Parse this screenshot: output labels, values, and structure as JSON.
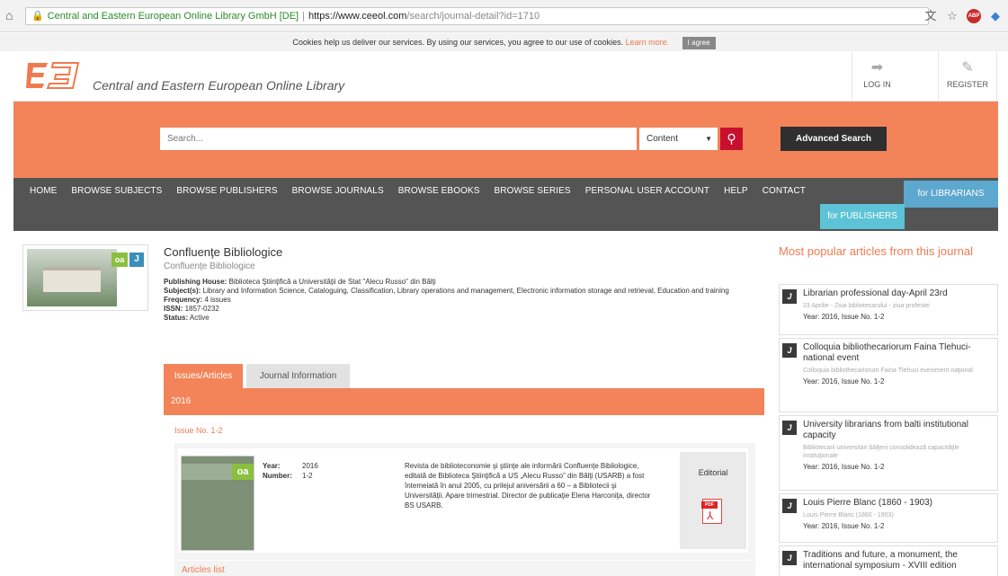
{
  "browser": {
    "site_label": "Central and Eastern European Online Library GmbH [DE]",
    "url_host": "https://www.ceeol.com",
    "url_path": "/search/journal-detail?id=1710",
    "abp_label": "ABP"
  },
  "cookie": {
    "text": "Cookies help us deliver our services. By using our services, you agree to our use of cookies.",
    "learn_more": "Learn more.",
    "agree": "I agree"
  },
  "header": {
    "site_name": "Central and Eastern European Online Library",
    "login": "LOG IN",
    "register": "REGISTER"
  },
  "search": {
    "placeholder": "Search...",
    "scope": "Content",
    "advanced": "Advanced Search"
  },
  "nav": {
    "items": [
      "HOME",
      "BROWSE SUBJECTS",
      "BROWSE PUBLISHERS",
      "BROWSE JOURNALS",
      "BROWSE EBOOKS",
      "BROWSE SERIES",
      "PERSONAL USER ACCOUNT",
      "HELP",
      "CONTACT"
    ],
    "for_librarians": "for LIBRARIANS",
    "for_publishers": "for PUBLISHERS"
  },
  "journal": {
    "title": "Confluenţe Bibliologice",
    "subtitle": "Confluenţe Bibliologice",
    "oa_badge": "oa",
    "j_badge": "J",
    "publishing_house_label": "Publishing House:",
    "publishing_house": "Biblioteca Ştiinţifică a Universităţii de Stat \"Alecu Russo\" din Bălţi",
    "subjects_label": "Subject(s):",
    "subjects": "Library and Information Science, Cataloguing, Classification, Library operations and management, Electronic information storage and retrieval, Education and training",
    "frequency_label": "Frequency:",
    "frequency": "4 issues",
    "issn_label": "ISSN:",
    "issn": "1857-0232",
    "status_label": "Status:",
    "status": "Active"
  },
  "tabs": {
    "issues": "Issues/Articles",
    "info": "Journal Information"
  },
  "issues": {
    "year": "2016",
    "issue_link": "Issue No. 1-2",
    "year_label": "Year:",
    "year_value": "2016",
    "number_label": "Number:",
    "number_value": "1-2",
    "description": "Revista de biblioteconomie şi ştiinţe ale informării Confluenţe Bibliologice, editată de Biblioteca Ştiinţifică a US „Alecu Russo” din Bălţi (USARB) a fost întemeiată în anul 2005, cu prilejul aniversării a 60 – a Bibliotecii şi Universităţii. Apare trimestrial. Director de publicaţie Elena Harconiţa, director BS USARB.",
    "editorial": "Editorial",
    "pdf_tag": "PDF",
    "articles_list": "Articles list",
    "cover_oa": "oa"
  },
  "popular": {
    "title": "Most popular articles from this journal",
    "articles": [
      {
        "title": "Librarian professional day-April 23rd",
        "sub": "23 Aprilie - Ziua bibliotecarului - ziua profesiei",
        "year": "Year: 2016, Issue No. 1-2"
      },
      {
        "title": "Colloquia bibliothecariorum Faina Tlehuci-national event",
        "sub": "Colloquia bibliothecariorum Faina Tlehuci eveniment naţional",
        "year": "Year: 2016, Issue No. 1-2"
      },
      {
        "title": "University librarians from balti institutional capacity",
        "sub": "Bibliotecarii universitari bălţeni consolidează capacităţile instituţionale",
        "year": "Year: 2016, Issue No. 1-2"
      },
      {
        "title": "Louis Pierre Blanc (1860 - 1903)",
        "sub": "Louis Pierre Blanc (1860 - 1903)",
        "year": "Year: 2016, Issue No. 1-2"
      },
      {
        "title": "Traditions and future, a monument, the international symposium - XVIII edition",
        "sub": "",
        "year": ""
      }
    ]
  }
}
